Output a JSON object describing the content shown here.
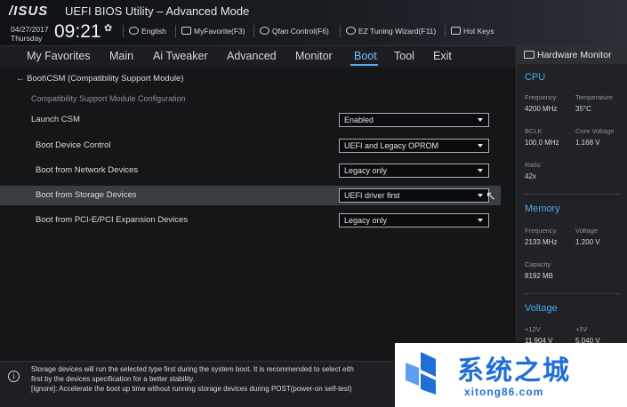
{
  "header": {
    "brand": "/ISUS",
    "title": "UEFI BIOS Utility – Advanced Mode",
    "date": "04/27/2017",
    "weekday": "Thursday",
    "time": "09:21",
    "settings_glyph": "✿",
    "tools": [
      {
        "label": "English",
        "icon": "globe-icon"
      },
      {
        "label": "MyFavorite(F3)",
        "icon": "favorite-icon"
      },
      {
        "label": "Qfan Control(F6)",
        "icon": "fan-icon"
      },
      {
        "label": "EZ Tuning Wizard(F11)",
        "icon": "bulb-icon"
      },
      {
        "label": "Hot Keys",
        "icon": "help-box-icon"
      }
    ]
  },
  "menu": {
    "items": [
      "My Favorites",
      "Main",
      "Ai Tweaker",
      "Advanced",
      "Monitor",
      "Boot",
      "Tool",
      "Exit"
    ],
    "active": "Boot",
    "accent": "#4eb0ff"
  },
  "content": {
    "back_glyph": "←",
    "breadcrumb": "Boot\\CSM (Compatibility Support Module)",
    "subtitle": "Compatibility Support Module Configuration",
    "settings": [
      {
        "label": "Launch CSM",
        "value": "Enabled"
      },
      {
        "label": "Boot Device Control",
        "value": "UEFI and Legacy OPROM"
      },
      {
        "label": "Boot from Network Devices",
        "value": "Legacy only"
      },
      {
        "label": "Boot from Storage Devices",
        "value": "UEFI driver first",
        "selected": true
      },
      {
        "label": "Boot from PCI-E/PCI Expansion Devices",
        "value": "Legacy only"
      }
    ]
  },
  "hardware_monitor": {
    "title": "Hardware Monitor",
    "cpu": {
      "section": "CPU",
      "frequency_label": "Frequency",
      "frequency": "4200 MHz",
      "temperature_label": "Temperature",
      "temperature": "35°C",
      "bclk_label": "BCLK",
      "bclk": "100.0 MHz",
      "core_voltage_label": "Core Voltage",
      "core_voltage": "1.168 V",
      "ratio_label": "Ratio",
      "ratio": "42x"
    },
    "memory": {
      "section": "Memory",
      "frequency_label": "Frequency",
      "frequency": "2133 MHz",
      "voltage_label": "Voltage",
      "voltage": "1.200 V",
      "capacity_label": "Capacity",
      "capacity": "8192 MB"
    },
    "voltage": {
      "section": "Voltage",
      "v12_label": "+12V",
      "v12": "11.904 V",
      "v5_label": "+5V",
      "v5": "5.040 V"
    },
    "accent": "#4aa8ee"
  },
  "help": {
    "info_glyph": "i",
    "lines": [
      "Storage devices will run the selected type first during the system boot. It is recommended to select eith",
      "first by the devices specification for a better stability.",
      "[Ignore]: Accelerate the boot up time without running storage devices during POST(power-on self-test)"
    ]
  },
  "watermark": {
    "name": "系统之城",
    "url": "xitong86.com",
    "color": "#1f6fd6"
  }
}
